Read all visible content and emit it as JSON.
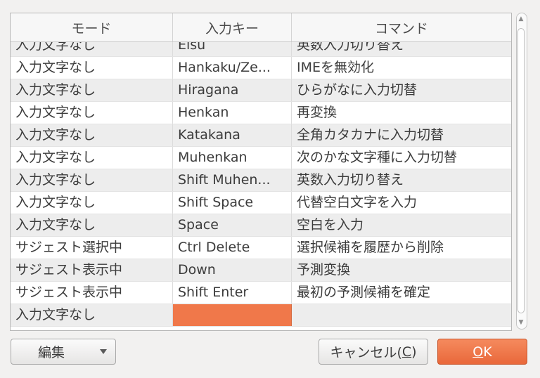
{
  "table": {
    "headers": [
      "モード",
      "入力キー",
      "コマンド"
    ],
    "rows": [
      [
        "入力文字なし",
        "Eisu",
        "英数入力切り替え"
      ],
      [
        "入力文字なし",
        "Hankaku/Ze...",
        "IMEを無効化"
      ],
      [
        "入力文字なし",
        "Hiragana",
        "ひらがなに入力切替"
      ],
      [
        "入力文字なし",
        "Henkan",
        "再変換"
      ],
      [
        "入力文字なし",
        "Katakana",
        "全角カタカナに入力切替"
      ],
      [
        "入力文字なし",
        "Muhenkan",
        "次のかな文字種に入力切替"
      ],
      [
        "入力文字なし",
        "Shift Muhen...",
        "英数入力切り替え"
      ],
      [
        "入力文字なし",
        "Shift Space",
        "代替空白文字を入力"
      ],
      [
        "入力文字なし",
        "Space",
        "空白を入力"
      ],
      [
        "サジェスト選択中",
        "Ctrl Delete",
        "選択候補を履歴から削除"
      ],
      [
        "サジェスト表示中",
        "Down",
        "予測変換"
      ],
      [
        "サジェスト表示中",
        "Shift Enter",
        "最初の予測候補を確定"
      ],
      [
        "入力文字なし",
        "",
        ""
      ]
    ]
  },
  "buttons": {
    "edit_label": "編集",
    "cancel_label_pre": "キャンセル(",
    "cancel_mnemonic": "C",
    "cancel_label_post": ")",
    "ok_mnemonic": "O",
    "ok_label_post": "K"
  },
  "colors": {
    "accent": "#f0784a",
    "ok_button": "#ee7447"
  }
}
